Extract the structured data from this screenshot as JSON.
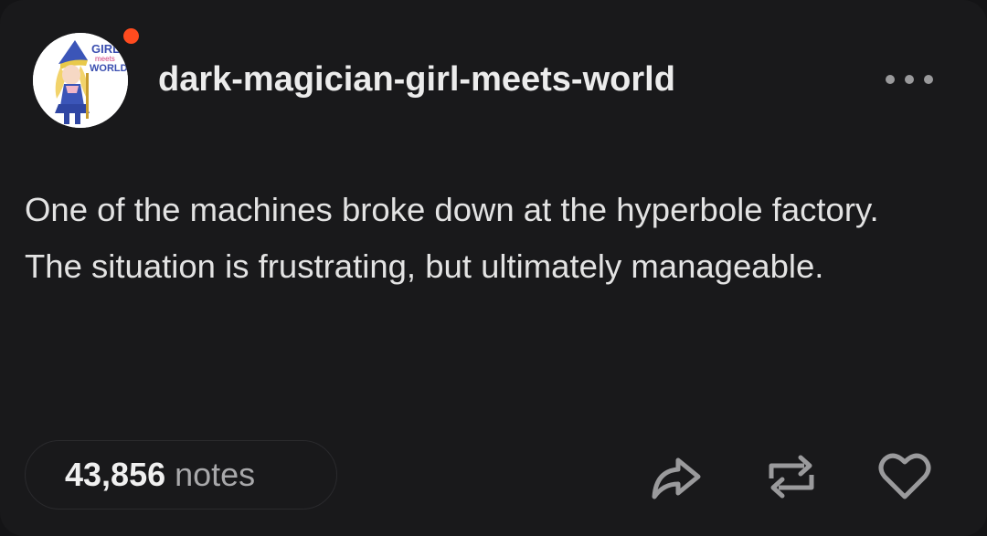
{
  "post": {
    "username": "dark-magician-girl-meets-world",
    "avatar_text": {
      "line1": "GIRL",
      "line2": "meets",
      "line3": "WORLD"
    },
    "body": "One of the machines broke down at the hyperbole factory. The situation is frustrating, but ultimately manageable.",
    "notes_count": "43,856",
    "notes_label": "notes"
  },
  "icons": {
    "more": "more-dots-icon",
    "share": "share-arrow-icon",
    "reblog": "reblog-icon",
    "like": "heart-icon"
  },
  "colors": {
    "background": "#19191b",
    "username": "#ececec",
    "body_text": "#e3e3e3",
    "muted": "#a8a8aa",
    "online_dot": "#ff4b1f",
    "icon": "#9a9a9c"
  }
}
